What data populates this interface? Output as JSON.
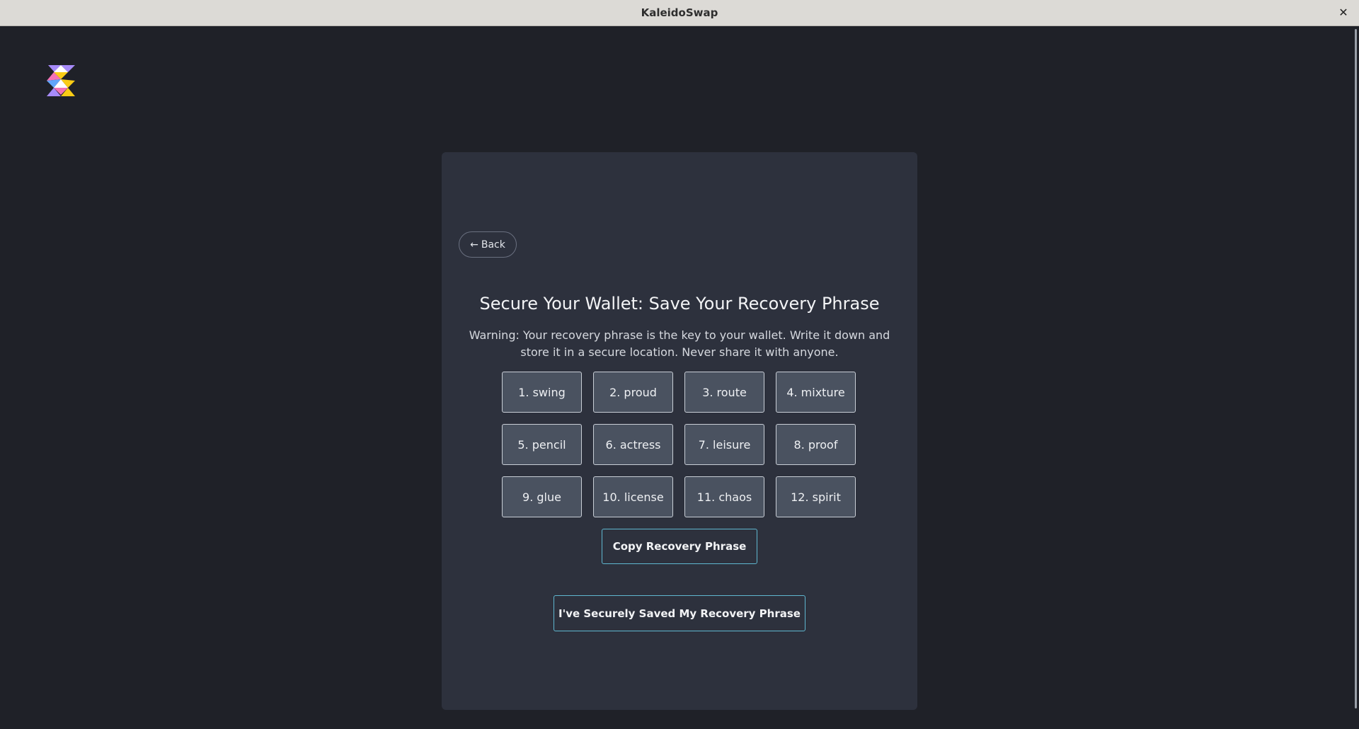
{
  "window": {
    "title": "KaleidoSwap",
    "close_glyph": "✕"
  },
  "logo": {
    "icon": "kaleidoswap-logo",
    "colors": [
      "#a78bfa",
      "#f472b6",
      "#facc15",
      "#60a5fa",
      "#ffffff"
    ]
  },
  "card": {
    "back_arrow": "←",
    "back_label": "Back",
    "heading": "Secure Your Wallet: Save Your Recovery Phrase",
    "warning": "Warning: Your recovery phrase is the key to your wallet. Write it down and store it in a secure location. Never share it with anyone.",
    "words": [
      "1. swing",
      "2. proud",
      "3. route",
      "4. mixture",
      "5. pencil",
      "6. actress",
      "7. leisure",
      "8. proof",
      "9. glue",
      "10. license",
      "11. chaos",
      "12. spirit"
    ],
    "copy_label": "Copy Recovery Phrase",
    "confirm_label": "I've Securely Saved My Recovery Phrase"
  },
  "colors": {
    "background": "#1f2128",
    "card": "#2d313d",
    "word_tile": "#4a5260",
    "accent_border": "#5fb7d0",
    "titlebar": "#dcdad6"
  }
}
